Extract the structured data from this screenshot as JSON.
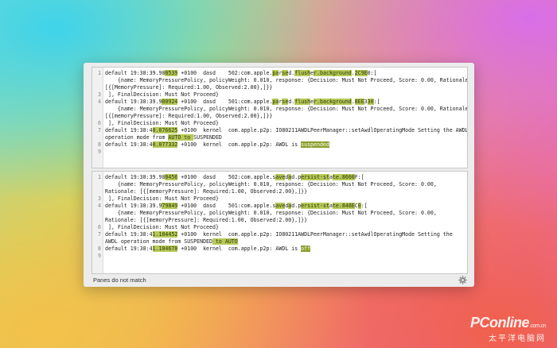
{
  "status": {
    "text": "Panes do not match"
  },
  "watermark": {
    "logo": "PConline",
    "suffix": ".com.cn",
    "cn": "太平洋电脑网"
  },
  "colors": {
    "highlight": "#b7c95a",
    "highlight_strong": "#8a9e2b"
  },
  "top_pane": {
    "lines": [
      {
        "n": "1",
        "segs": [
          [
            "default 19:38:39.98",
            "n"
          ],
          [
            "0539",
            "h"
          ],
          [
            " +0100  dasd    502:com.apple.",
            "n"
          ],
          [
            "pa",
            "h"
          ],
          [
            "r",
            "n"
          ],
          [
            "se",
            "h"
          ],
          [
            "d.",
            "n"
          ],
          [
            "flush",
            "h"
          ],
          [
            "e",
            "n"
          ],
          [
            "r.b",
            "h"
          ],
          [
            "ackground",
            "h"
          ],
          [
            ".",
            "n"
          ],
          [
            "2C9E",
            "h"
          ],
          [
            "0:[",
            "n"
          ]
        ]
      },
      {
        "n": "",
        "segs": [
          [
            "    {name: MemoryPressurePolicy, policyWeight: 0.010, response: {Decision: Must Not Proceed, Score: 0.00, Rationale",
            "n"
          ]
        ]
      },
      {
        "n": "",
        "segs": [
          [
            "[{[MemoryPressure]: Required:1.00, Observed:2.00},]}}",
            "n"
          ]
        ]
      },
      {
        "n": "3",
        "segs": [
          [
            " ], FinalDecision: Must Not Proceed}",
            "n"
          ]
        ]
      },
      {
        "n": "4",
        "segs": [
          [
            "default 19:38:39.9",
            "n"
          ],
          [
            "80924",
            "h"
          ],
          [
            " +0100  dasd    501:com.apple.",
            "n"
          ],
          [
            "pa",
            "h"
          ],
          [
            "r",
            "n"
          ],
          [
            "se",
            "h"
          ],
          [
            "d.",
            "n"
          ],
          [
            "flush",
            "h"
          ],
          [
            "e",
            "n"
          ],
          [
            "r.b",
            "h"
          ],
          [
            "ackground",
            "h"
          ],
          [
            ".",
            "n"
          ],
          [
            "8EE",
            "h"
          ],
          [
            "3",
            "n"
          ],
          [
            "30",
            "h"
          ],
          [
            ":[",
            "n"
          ]
        ]
      },
      {
        "n": "",
        "segs": [
          [
            "    {name: MemoryPressurePolicy, policyWeight: 0.010, response: {Decision: Must Not Proceed, Score: 0.00, Rationale",
            "n"
          ]
        ]
      },
      {
        "n": "",
        "segs": [
          [
            "[{[memoryPressure]: Required:1.00, Observed:2.00},]}}",
            "n"
          ]
        ]
      },
      {
        "n": "6",
        "segs": [
          [
            " ], FinalDecision: Must Not Proceed}",
            "n"
          ]
        ]
      },
      {
        "n": "7",
        "segs": [
          [
            "default 19:38:4",
            "n"
          ],
          [
            "0.076625",
            "h"
          ],
          [
            " +0100  kernel  com.apple.p2p: IO80211AWDLPeerManager::setAwdlOperatingMode Setting the AWDL",
            "n"
          ]
        ]
      },
      {
        "n": "",
        "segs": [
          [
            "operation mode from ",
            "n"
          ],
          [
            "AUTO to ",
            "h"
          ],
          [
            "SUSPENDED",
            "n"
          ]
        ]
      },
      {
        "n": "8",
        "segs": [
          [
            "default 19:38:4",
            "n"
          ],
          [
            "0.077332",
            "h"
          ],
          [
            " +0100  kernel  com.apple.p2p: AWDL is ",
            "n"
          ],
          [
            "suspended",
            "s"
          ]
        ]
      },
      {
        "n": "9",
        "segs": [
          [
            "",
            "n"
          ]
        ]
      }
    ]
  },
  "bottom_pane": {
    "lines": [
      {
        "n": "1",
        "segs": [
          [
            "default 19:38:39.98",
            "n"
          ],
          [
            "0456",
            "h"
          ],
          [
            " +0100  dasd    502:com.apple.",
            "n"
          ],
          [
            "s",
            "n"
          ],
          [
            "ave",
            "h"
          ],
          [
            "d",
            "n"
          ],
          [
            "a",
            "h"
          ],
          [
            "d.",
            "n"
          ],
          [
            "p",
            "n"
          ],
          [
            "ersist-st",
            "h"
          ],
          [
            "a",
            "n"
          ],
          [
            "te.",
            "h"
          ],
          [
            "8660",
            "h"
          ],
          [
            "F:[",
            "n"
          ]
        ]
      },
      {
        "n": "",
        "segs": [
          [
            "    {name: MemoryPressurePolicy, policyWeight: 0.010, response: {Decision: Must Not Proceed, Score: 0.00,",
            "n"
          ]
        ]
      },
      {
        "n": "",
        "segs": [
          [
            "Rationale: [{[memoryPressure]: Required:1.00, Observed:2.00},]}}",
            "n"
          ]
        ]
      },
      {
        "n": "3",
        "segs": [
          [
            " ], FinalDecision: Must Not Proceed}",
            "n"
          ]
        ]
      },
      {
        "n": "4",
        "segs": [
          [
            "default 19:38:39.9",
            "n"
          ],
          [
            "79849",
            "h"
          ],
          [
            " +0100  dasd    501:com.apple.",
            "n"
          ],
          [
            "s",
            "n"
          ],
          [
            "ave",
            "h"
          ],
          [
            "d",
            "n"
          ],
          [
            "a",
            "h"
          ],
          [
            "d.",
            "n"
          ],
          [
            "p",
            "n"
          ],
          [
            "ersist-st",
            "h"
          ],
          [
            "a",
            "n"
          ],
          [
            "te.",
            "h"
          ],
          [
            "848E",
            "h"
          ],
          [
            "C",
            "n"
          ],
          [
            "0",
            "h"
          ],
          [
            ":[",
            "n"
          ]
        ]
      },
      {
        "n": "",
        "segs": [
          [
            "    {name: MemoryPressurePolicy, policyWeight: 0.010, response: {Decision: Must Not Proceed, Score: 0.00,",
            "n"
          ]
        ]
      },
      {
        "n": "",
        "segs": [
          [
            "Rationale: [{[memoryPressure]: Required:1.00, Observed:2.00},]}}",
            "n"
          ]
        ]
      },
      {
        "n": "6",
        "segs": [
          [
            " ], FinalDecision: Must Not Proceed}",
            "n"
          ]
        ]
      },
      {
        "n": "7",
        "segs": [
          [
            "default 19:38:4",
            "n"
          ],
          [
            "1.104452",
            "h"
          ],
          [
            " +0100  kernel  com.apple.p2p: IO80211AWDLPeerManager::setAwdlOperatingMode Setting the",
            "n"
          ]
        ]
      },
      {
        "n": "",
        "segs": [
          [
            "AWDL operation mode from SUSPENDED",
            "n"
          ],
          [
            " to AUTO",
            "h"
          ]
        ]
      },
      {
        "n": "8",
        "segs": [
          [
            "default 19:38:4",
            "n"
          ],
          [
            "1.104670",
            "h"
          ],
          [
            " +0100  kernel  com.apple.p2p: AWDL is ",
            "n"
          ],
          [
            "off",
            "s"
          ]
        ]
      },
      {
        "n": "9",
        "segs": [
          [
            "",
            "n"
          ]
        ]
      }
    ]
  }
}
